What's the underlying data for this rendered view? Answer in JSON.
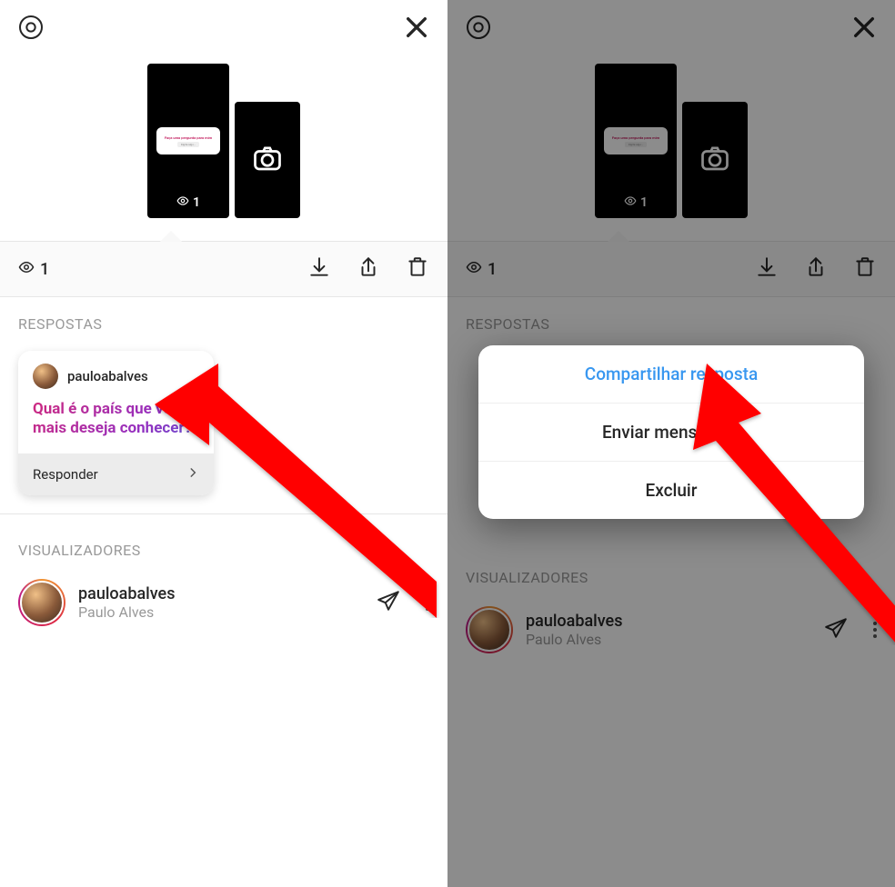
{
  "screens": {
    "left": {
      "viewcount": "1",
      "thumb_viewcount": "1",
      "actionbar_count": "1",
      "responses_header": "RESPOSTAS",
      "viewers_header": "VISUALIZADORES",
      "response": {
        "username": "pauloabalves",
        "question": "Qual é o país que você mais deseja conhecer?",
        "responder_label": "Responder"
      },
      "viewer": {
        "username": "pauloabalves",
        "fullname": "Paulo Alves"
      },
      "thumb_sticker_title": "Faça uma pergunta para mim",
      "thumb_sticker_sub": "Digite algo..."
    },
    "right": {
      "viewcount": "1",
      "thumb_viewcount": "1",
      "actionbar_count": "1",
      "responses_header": "RESPOSTAS",
      "viewers_header": "VISUALIZADORES",
      "viewer": {
        "username": "pauloabalves",
        "fullname": "Paulo Alves"
      },
      "thumb_sticker_title": "Faça uma pergunta para mim",
      "thumb_sticker_sub": "Digite algo...",
      "modal": {
        "share": "Compartilhar resposta",
        "send": "Enviar mensagem",
        "delete": "Excluir"
      }
    }
  },
  "colors": {
    "accent_blue": "#3897f0",
    "arrow_red": "#ff0000",
    "heading_grey": "#999999"
  }
}
